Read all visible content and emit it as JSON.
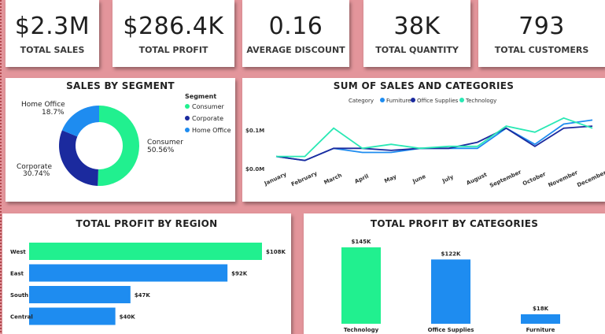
{
  "kpis": [
    {
      "value": "$2.3M",
      "label": "TOTAL SALES"
    },
    {
      "value": "$286.4K",
      "label": "TOTAL PROFIT"
    },
    {
      "value": "0.16",
      "label": "AVERAGE DISCOUNT"
    },
    {
      "value": "38K",
      "label": "TOTAL QUANTITY"
    },
    {
      "value": "793",
      "label": "TOTAL CUSTOMERS"
    }
  ],
  "colors": {
    "page_bg": "#e3959b",
    "consumer": "#21f08f",
    "corporate": "#1b2a9e",
    "home_office": "#1e8cf0",
    "furniture": "#1e8cf0",
    "office_supplies": "#1b2a9e",
    "technology": "#29e8b4"
  },
  "segment": {
    "title": "SALES BY SEGMENT",
    "legend_title": "Segment",
    "legend_items": [
      "Consumer",
      "Corporate",
      "Home Office"
    ],
    "slice_labels": [
      {
        "name": "Consumer",
        "pct": "50.56%"
      },
      {
        "name": "Corporate",
        "pct": "30.74%"
      },
      {
        "name": "Home Office",
        "pct": "18.7%"
      }
    ]
  },
  "line": {
    "title": "SUM OF SALES AND CATEGORIES",
    "legend_title": "Category",
    "legend_items": [
      "Furniture",
      "Office Supplies",
      "Technology"
    ],
    "y_ticks": [
      "$0.1M",
      "$0.0M"
    ],
    "months": [
      "January",
      "February",
      "March",
      "April",
      "May",
      "June",
      "July",
      "August",
      "September",
      "October",
      "November",
      "December"
    ]
  },
  "region": {
    "title": "TOTAL PROFIT BY REGION",
    "regions": [
      "West",
      "East",
      "South",
      "Central"
    ],
    "value_labels": [
      "$108K",
      "$92K",
      "$47K",
      "$40K"
    ]
  },
  "categories_profit": {
    "title": "TOTAL PROFIT BY CATEGORIES",
    "categories": [
      "Technology",
      "Office Supplies",
      "Furniture"
    ],
    "value_labels": [
      "$145K",
      "$122K",
      "$18K"
    ]
  },
  "chart_data": [
    {
      "type": "pie",
      "title": "SALES BY SEGMENT",
      "categories": [
        "Consumer",
        "Corporate",
        "Home Office"
      ],
      "values": [
        50.56,
        30.74,
        18.7
      ],
      "legend": "right"
    },
    {
      "type": "line",
      "title": "SUM OF SALES AND CATEGORIES",
      "x": [
        "January",
        "February",
        "March",
        "April",
        "May",
        "June",
        "July",
        "August",
        "September",
        "October",
        "November",
        "December"
      ],
      "ylim": [
        0,
        0.15
      ],
      "series": [
        {
          "name": "Furniture",
          "values": [
            0.03,
            0.02,
            0.05,
            0.04,
            0.04,
            0.05,
            0.05,
            0.05,
            0.1,
            0.06,
            0.11,
            0.12
          ]
        },
        {
          "name": "Office Supplies",
          "values": [
            0.03,
            0.02,
            0.05,
            0.05,
            0.045,
            0.05,
            0.05,
            0.065,
            0.1,
            0.055,
            0.1,
            0.105
          ]
        },
        {
          "name": "Technology",
          "values": [
            0.03,
            0.03,
            0.1,
            0.05,
            0.06,
            0.05,
            0.055,
            0.055,
            0.105,
            0.09,
            0.125,
            0.1
          ]
        }
      ],
      "legend": "top"
    },
    {
      "type": "bar",
      "orientation": "horizontal",
      "title": "TOTAL PROFIT BY REGION",
      "categories": [
        "West",
        "East",
        "South",
        "Central"
      ],
      "values": [
        108,
        92,
        47,
        40
      ],
      "unit": "K"
    },
    {
      "type": "bar",
      "title": "TOTAL PROFIT BY CATEGORIES",
      "categories": [
        "Technology",
        "Office Supplies",
        "Furniture"
      ],
      "values": [
        145,
        122,
        18
      ],
      "unit": "K"
    }
  ]
}
